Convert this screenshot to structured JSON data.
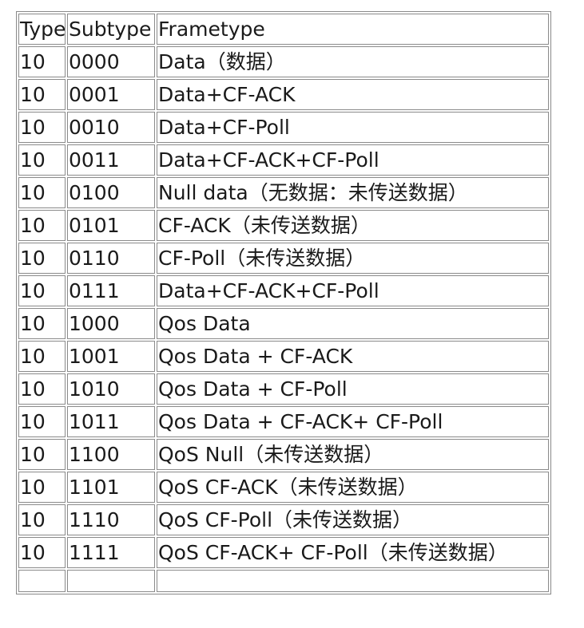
{
  "table": {
    "headers": {
      "type": "Type",
      "subtype": "Subtype",
      "frametype": "Frametype"
    },
    "rows": [
      {
        "type": "10",
        "subtype": "0000",
        "frametype": "Data（数据）"
      },
      {
        "type": "10",
        "subtype": "0001",
        "frametype": "Data+CF-ACK"
      },
      {
        "type": "10",
        "subtype": "0010",
        "frametype": "Data+CF-Poll"
      },
      {
        "type": "10",
        "subtype": "0011",
        "frametype": "Data+CF-ACK+CF-Poll"
      },
      {
        "type": "10",
        "subtype": "0100",
        "frametype": "Null data（无数据：未传送数据）"
      },
      {
        "type": "10",
        "subtype": "0101",
        "frametype": "CF-ACK（未传送数据）"
      },
      {
        "type": "10",
        "subtype": "0110",
        "frametype": "CF-Poll（未传送数据）"
      },
      {
        "type": "10",
        "subtype": "0111",
        "frametype": "Data+CF-ACK+CF-Poll"
      },
      {
        "type": "10",
        "subtype": "1000",
        "frametype": "Qos Data"
      },
      {
        "type": "10",
        "subtype": "1001",
        "frametype": "Qos Data + CF-ACK"
      },
      {
        "type": "10",
        "subtype": "1010",
        "frametype": "Qos Data + CF-Poll"
      },
      {
        "type": "10",
        "subtype": "1011",
        "frametype": "Qos Data + CF-ACK+ CF-Poll"
      },
      {
        "type": "10",
        "subtype": "1100",
        "frametype": "QoS Null（未传送数据）"
      },
      {
        "type": "10",
        "subtype": "1101",
        "frametype": "QoS CF-ACK（未传送数据）"
      },
      {
        "type": "10",
        "subtype": "1110",
        "frametype": "QoS CF-Poll（未传送数据）"
      },
      {
        "type": "10",
        "subtype": "1111",
        "frametype": "QoS CF-ACK+ CF-Poll（未传送数据）"
      }
    ]
  }
}
